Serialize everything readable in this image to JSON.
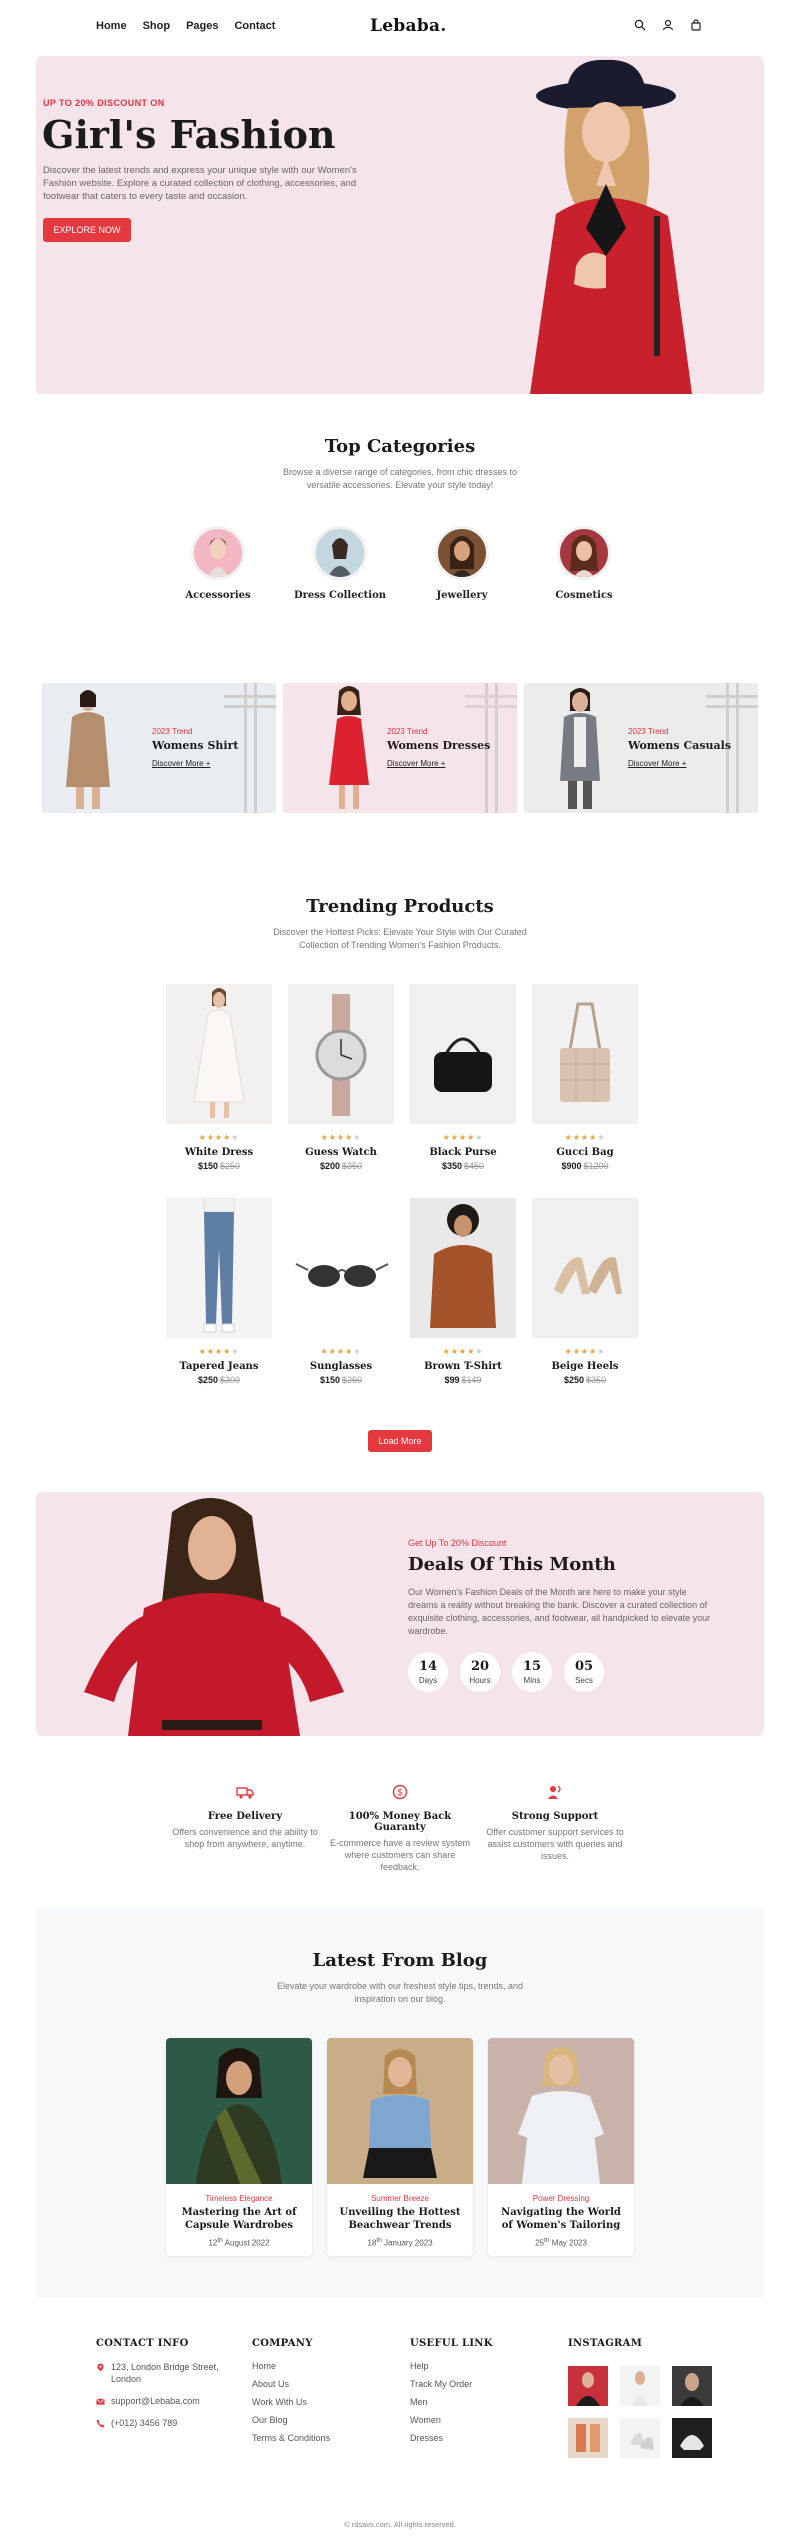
{
  "nav": {
    "links": [
      "Home",
      "Shop",
      "Pages",
      "Contact"
    ],
    "logo": "Lebaba.",
    "icons": [
      "search-icon",
      "user-icon",
      "bag-icon"
    ]
  },
  "hero": {
    "kicker": "UP TO 20% DISCOUNT ON",
    "title": "Girl's Fashion",
    "description": "Discover the latest trends and express your unique style with our Women's Fashion website. Explore a curated collection of clothing, accessories, and footwear that caters to every taste and occasion.",
    "button": "EXPLORE NOW"
  },
  "categories": {
    "title": "Top Categories",
    "subtitle": "Browse a diverse range of categories, from chic dresses to versatile accessories. Elevate your style today!",
    "items": [
      "Accessories",
      "Dress Collection",
      "Jewellery",
      "Cosmetics"
    ]
  },
  "promos": [
    {
      "kicker": "2023 Trend",
      "title": "Womens Shirt",
      "link": "Discover More +"
    },
    {
      "kicker": "2023 Trend",
      "title": "Womens Dresses",
      "link": "Discover More +"
    },
    {
      "kicker": "2023 Trend",
      "title": "Womens Casuals",
      "link": "Discover More +"
    }
  ],
  "products": {
    "title": "Trending Products",
    "subtitle": "Discover the Hottest Picks: Elevate Your Style with Our Curated Collection of Trending Women's Fashion Products.",
    "items": [
      {
        "name": "White Dress",
        "price": "$150",
        "old": "$250",
        "rating": 4
      },
      {
        "name": "Guess Watch",
        "price": "$200",
        "old": "$350",
        "rating": 4
      },
      {
        "name": "Black Purse",
        "price": "$350",
        "old": "$450",
        "rating": 4
      },
      {
        "name": "Gucci Bag",
        "price": "$900",
        "old": "$1200",
        "rating": 4
      },
      {
        "name": "Tapered Jeans",
        "price": "$250",
        "old": "$300",
        "rating": 4
      },
      {
        "name": "Sunglasses",
        "price": "$150",
        "old": "$250",
        "rating": 4
      },
      {
        "name": "Brown T-Shirt",
        "price": "$99",
        "old": "$149",
        "rating": 4
      },
      {
        "name": "Beige Heels",
        "price": "$250",
        "old": "$350",
        "rating": 4
      }
    ],
    "load_more": "Load More"
  },
  "deals": {
    "kicker": "Get Up To 20% Discount",
    "title": "Deals Of This Month",
    "description": "Our Women's Fashion Deals of the Month are here to make your style dreams a reality without breaking the bank. Discover a curated collection of exquisite clothing, accessories, and footwear, all handpicked to elevate your wardrobe.",
    "timer": [
      {
        "value": "14",
        "label": "Days"
      },
      {
        "value": "20",
        "label": "Hours"
      },
      {
        "value": "15",
        "label": "Mins"
      },
      {
        "value": "05",
        "label": "Secs"
      }
    ]
  },
  "features": [
    {
      "icon": "truck-icon",
      "title": "Free Delivery",
      "desc": "Offers convenience and the ability to shop from anywhere, anytime."
    },
    {
      "icon": "money-back-icon",
      "title": "100% Money Back Guaranty",
      "desc": "E-commerce have a review system where customers can share feedback."
    },
    {
      "icon": "support-icon",
      "title": "Strong Support",
      "desc": "Offer customer support services to assist customers with queries and issues."
    }
  ],
  "blog": {
    "title": "Latest From Blog",
    "subtitle": "Elevate your wardrobe with our freshest style tips, trends, and inspiration on our blog.",
    "posts": [
      {
        "tag": "Timeless Elegance",
        "title": "Mastering the Art of Capsule Wardrobes",
        "day": "12",
        "sup": "th",
        "rest": "August 2022"
      },
      {
        "tag": "Summer Breeze",
        "title": "Unveiling the Hottest Beachwear Trends",
        "day": "18",
        "sup": "th",
        "rest": "January 2023"
      },
      {
        "tag": "Power Dressing",
        "title": "Navigating the World of Women's Tailoring",
        "day": "25",
        "sup": "th",
        "rest": "May 2023"
      }
    ]
  },
  "footer": {
    "contact": {
      "heading": "CONTACT INFO",
      "address": "123, London Bridge Street, London",
      "email": "support@Lebaba.com",
      "phone": "(+012) 3456 789"
    },
    "company": {
      "heading": "COMPANY",
      "links": [
        "Home",
        "About Us",
        "Work With Us",
        "Our Blog",
        "Terms & Conditions"
      ]
    },
    "useful": {
      "heading": "USEFUL LINK",
      "links": [
        "Help",
        "Track My Order",
        "Men",
        "Women",
        "Dresses"
      ]
    },
    "instagram": {
      "heading": "INSTAGRAM"
    },
    "copyright": "© rdsavs.com. All rights reserved."
  },
  "colors": {
    "accent": "#e5383f",
    "pink": "#f5e4ea"
  }
}
